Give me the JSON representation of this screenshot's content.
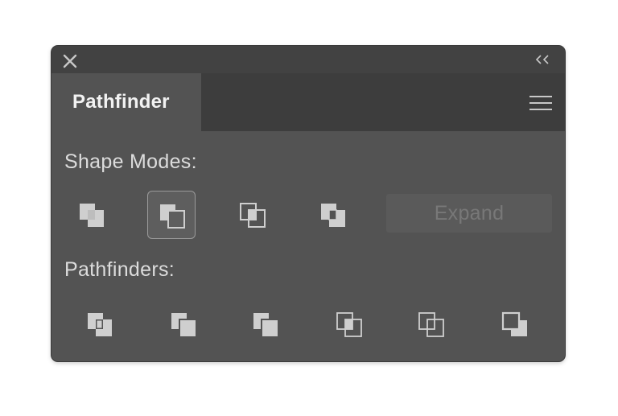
{
  "panel": {
    "tab_title": "Pathfinder",
    "close_icon": "close-icon",
    "collapse_icon": "double-chevron-left-icon",
    "menu_icon": "hamburger-menu-icon"
  },
  "shape_modes": {
    "label": "Shape Modes:",
    "buttons": [
      {
        "name": "unite",
        "icon": "unite-icon",
        "selected": false
      },
      {
        "name": "minus-front",
        "icon": "minus-front-icon",
        "selected": true
      },
      {
        "name": "intersect",
        "icon": "intersect-icon",
        "selected": false
      },
      {
        "name": "exclude",
        "icon": "exclude-icon",
        "selected": false
      }
    ],
    "expand_label": "Expand",
    "expand_enabled": false
  },
  "pathfinders": {
    "label": "Pathfinders:",
    "buttons": [
      {
        "name": "divide",
        "icon": "divide-icon"
      },
      {
        "name": "trim",
        "icon": "trim-icon"
      },
      {
        "name": "merge",
        "icon": "merge-icon"
      },
      {
        "name": "crop",
        "icon": "crop-icon"
      },
      {
        "name": "outline",
        "icon": "outline-icon"
      },
      {
        "name": "minus-back",
        "icon": "minus-back-icon"
      }
    ]
  },
  "colors": {
    "panel_bg": "#535353",
    "titlebar_bg": "#424242",
    "tabbar_bg": "#3d3d3d",
    "icon_fill": "#cfcfcf",
    "text": "#dcdcdc"
  }
}
